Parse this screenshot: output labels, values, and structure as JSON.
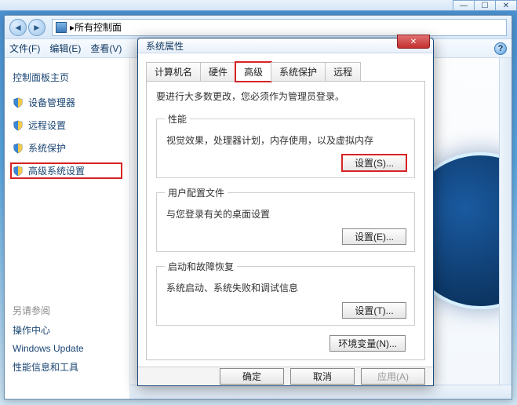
{
  "explorer": {
    "addressbar_text": "所有控制面",
    "menu": {
      "file": "文件(F)",
      "edit": "编辑(E)",
      "view": "查看(V)"
    }
  },
  "sidebar": {
    "heading": "控制面板主页",
    "items": [
      {
        "label": "设备管理器"
      },
      {
        "label": "远程设置"
      },
      {
        "label": "系统保护"
      },
      {
        "label": "高级系统设置",
        "highlight": true
      }
    ],
    "seealso_heading": "另请参阅",
    "seealso": [
      {
        "label": "操作中心"
      },
      {
        "label": "Windows Update"
      },
      {
        "label": "性能信息和工具"
      }
    ]
  },
  "dialog": {
    "title": "系统属性",
    "tabs": {
      "computer_name": "计算机名",
      "hardware": "硬件",
      "advanced": "高级",
      "system_protection": "系统保护",
      "remote": "远程"
    },
    "admin_note": "要进行大多数更改，您必须作为管理员登录。",
    "performance": {
      "legend": "性能",
      "desc": "视觉效果，处理器计划，内存使用，以及虚拟内存",
      "button": "设置(S)..."
    },
    "userprofile": {
      "legend": "用户配置文件",
      "desc": "与您登录有关的桌面设置",
      "button": "设置(E)..."
    },
    "startup": {
      "legend": "启动和故障恢复",
      "desc": "系统启动、系统失败和调试信息",
      "button": "设置(T)..."
    },
    "env_button": "环境变量(N)...",
    "buttons": {
      "ok": "确定",
      "cancel": "取消",
      "apply": "应用(A)"
    }
  }
}
